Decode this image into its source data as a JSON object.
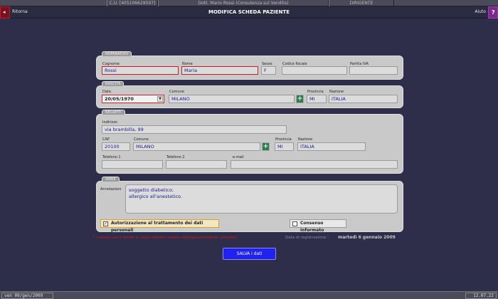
{
  "header": {
    "cu_code": "C.U. [405106629597]",
    "doctor": "Dott. Mario Rossi (Consulenza sul Vendita)",
    "role": "DIRIGENTE",
    "back_label": "Ritorna",
    "title": "MODIFICA SCHEDA PAZIENTE",
    "help_label": "Aiuto",
    "help_glyph": "?",
    "back_glyph": "◂"
  },
  "nominativo": {
    "section_label": "NOMINATIVO",
    "cognome_label": "Cognome",
    "cognome_value": "Rossi",
    "nome_label": "Nome",
    "nome_value": "Maria",
    "sesso_label": "Sesso",
    "sesso_value": "F",
    "codice_fiscale_label": "Codice fiscale",
    "codice_fiscale_value": "",
    "partita_iva_label": "Partita IVA",
    "partita_iva_value": ""
  },
  "nascita": {
    "section_label": "NASCITA",
    "data_label": "Data",
    "data_value": "20/05/1970",
    "comune_label": "Comune",
    "comune_value": "MILANO",
    "provincia_label": "Provincia",
    "provincia_value": "MI",
    "nazione_label": "Nazione",
    "nazione_value": "ITALIA"
  },
  "recapiti": {
    "section_label": "RECAPITI",
    "indirizzo_label": "Indirizzo",
    "indirizzo_value": "via brambilla, 99",
    "cap_label": "CAP",
    "cap_value": "20100",
    "comune_label": "Comune",
    "comune_value": "MILANO",
    "provincia_label": "Provincia",
    "provincia_value": "MI",
    "nazione_label": "Nazione",
    "nazione_value": "ITALIA",
    "telefono1_label": "Telefono 1",
    "telefono1_value": "",
    "telefono2_label": "Telefono 2",
    "telefono2_value": "",
    "email_label": "e-mail",
    "email_value": ""
  },
  "varie": {
    "section_label": "VARIE",
    "annotazioni_label": "Annotazioni",
    "annotazioni_value": "soggetto diabetico;\nallergico all'anestetico.",
    "autorizzazione_label": "Autorizzazione al trattamento dei dati personali",
    "autorizzazione_checked": true,
    "autorizzazione_mark": "✓",
    "consenso_label": "Consenso informato",
    "consenso_checked": false
  },
  "footer_note": "* I campi con il bordo in rosso devono essere obbligatoriamente compilati",
  "registration": {
    "label": "Data di registrazione :",
    "value": "martedì 6 gennaio 2009"
  },
  "save_label": "SALVA i dati",
  "status": {
    "date": "ven 09/gen/2009",
    "time": "12.07.22"
  },
  "colors": {
    "background": "#2e2e4a",
    "panel": "#c9c9c9",
    "required_border": "#c0202a",
    "save_button": "#2222ee",
    "field_text": "#1a1a8a"
  }
}
